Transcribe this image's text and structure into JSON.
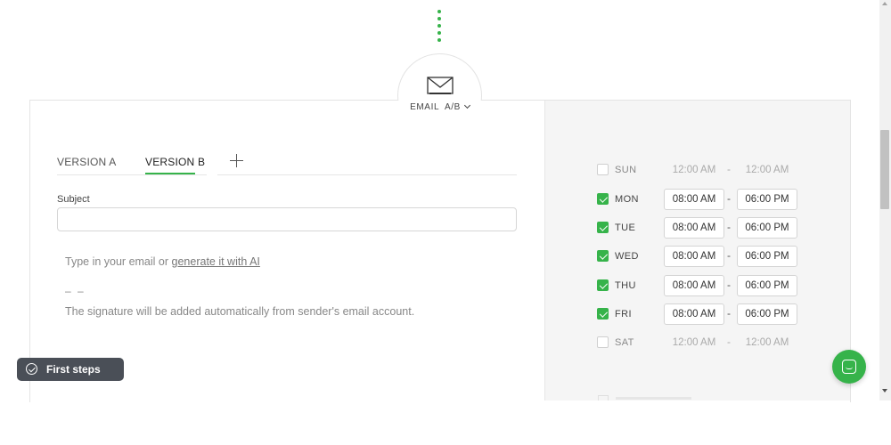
{
  "node": {
    "label": "EMAIL  A/B",
    "icon": "envelope-icon"
  },
  "editor": {
    "tabs": [
      {
        "label": "VERSION A",
        "active": false
      },
      {
        "label": "VERSION B",
        "active": true
      }
    ],
    "add_tab_icon": "plus-icon",
    "subject_label": "Subject",
    "subject_value": "",
    "body_prefix": "Type in your email or",
    "body_link": "generate it with AI",
    "signature_dash": "– –",
    "signature_note": "The signature will be added automatically from sender's email account."
  },
  "schedule": [
    {
      "day": "SUN",
      "checked": false,
      "from": "12:00 AM",
      "to": "12:00 AM"
    },
    {
      "day": "MON",
      "checked": true,
      "from": "08:00 AM",
      "to": "06:00 PM"
    },
    {
      "day": "TUE",
      "checked": true,
      "from": "08:00 AM",
      "to": "06:00 PM"
    },
    {
      "day": "WED",
      "checked": true,
      "from": "08:00 AM",
      "to": "06:00 PM"
    },
    {
      "day": "THU",
      "checked": true,
      "from": "08:00 AM",
      "to": "06:00 PM"
    },
    {
      "day": "FRI",
      "checked": true,
      "from": "08:00 AM",
      "to": "06:00 PM"
    },
    {
      "day": "SAT",
      "checked": false,
      "from": "12:00 AM",
      "to": "12:00 AM"
    }
  ],
  "range_separator": "-",
  "first_steps": {
    "label": "First steps"
  },
  "chat": {
    "icon": "chat-icon"
  },
  "colors": {
    "accent": "#36b34a",
    "panel": "#f5f5f5",
    "badge": "#4a4f57"
  }
}
